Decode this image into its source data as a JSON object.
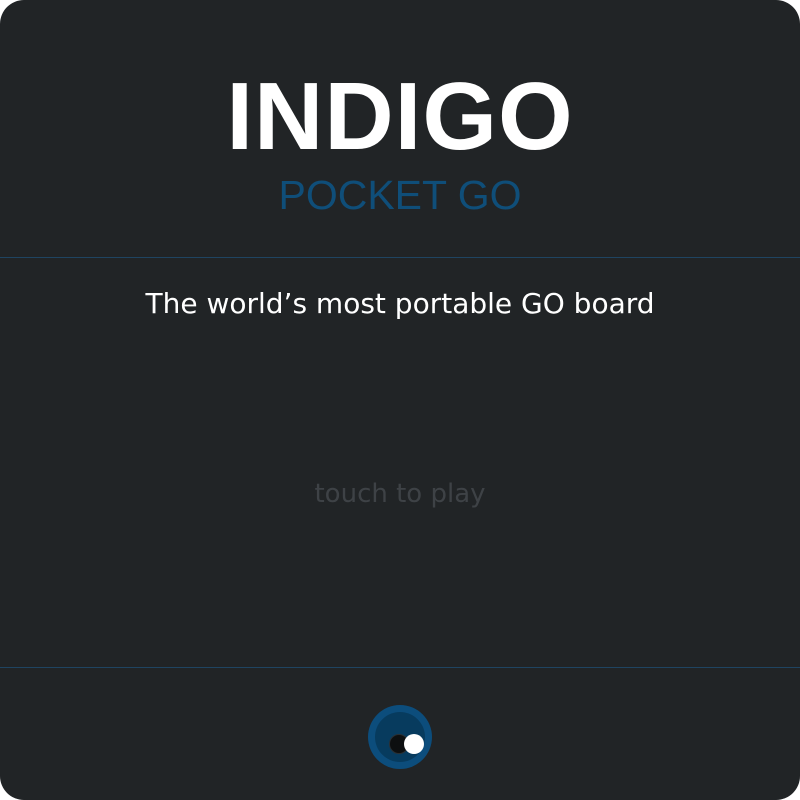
{
  "app": {
    "title": "INDIGO",
    "subtitle": "POCKET GO",
    "tagline": "The world’s most portable GO board",
    "play_hint": "touch to play"
  },
  "colors": {
    "background": "#212426",
    "accent": "#0f4e79",
    "title": "#ffffff",
    "hint": "#3e4246",
    "divider": "#1f4461"
  },
  "icons": {
    "toggle": "go-stones-icon"
  }
}
